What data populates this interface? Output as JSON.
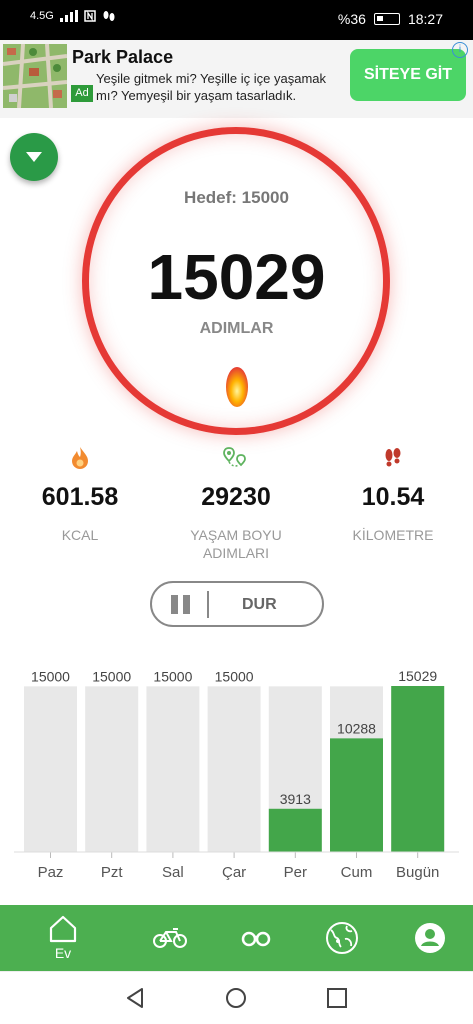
{
  "status": {
    "network": "4.5G",
    "battery": "%36",
    "time": "18:27"
  },
  "ad": {
    "title": "Park Palace",
    "text": "Yeşile gitmek mi? Yeşille iç içe yaşamak mı? Yemyeşil bir yaşam tasarladık.",
    "badge": "Ad",
    "cta": "SİTEYE GİT",
    "info": "i"
  },
  "goal": {
    "label": "Hedef: 15000",
    "steps": "15029",
    "steps_label": "ADIMLAR"
  },
  "stats": [
    {
      "value": "601.58",
      "label": "KCAL",
      "icon": "flame-icon"
    },
    {
      "value": "29230",
      "label": "YAŞAM BOYU ADIMLARI",
      "icon": "route-icon"
    },
    {
      "value": "10.54",
      "label": "KİLOMETRE",
      "icon": "footprints-icon"
    }
  ],
  "pause": {
    "label": "DUR"
  },
  "colors": {
    "accent": "#4caf50",
    "ring": "#e53935",
    "bar_done": "#43a64a",
    "bar_goal": "#e8e8e8"
  },
  "chart_data": {
    "type": "bar",
    "categories": [
      "Paz",
      "Pzt",
      "Sal",
      "Çar",
      "Per",
      "Cum",
      "Bugün"
    ],
    "series": [
      {
        "values": [
          15000,
          15000,
          15000,
          15000,
          15000,
          15000,
          15000
        ]
      },
      {
        "values": [
          0,
          0,
          0,
          0,
          3913,
          10288,
          15029
        ]
      }
    ],
    "labels": [
      "15000",
      "15000",
      "15000",
      "15000",
      "3913",
      "10288",
      "15029"
    ],
    "ylim": [
      0,
      15029
    ]
  },
  "nav": {
    "items": [
      {
        "label": "Ev",
        "icon": "home-icon"
      },
      {
        "label": "",
        "icon": "bike-icon"
      },
      {
        "label": "",
        "icon": "binoculars-icon"
      },
      {
        "label": "",
        "icon": "globe-icon"
      },
      {
        "label": "",
        "icon": "profile-icon"
      }
    ]
  }
}
